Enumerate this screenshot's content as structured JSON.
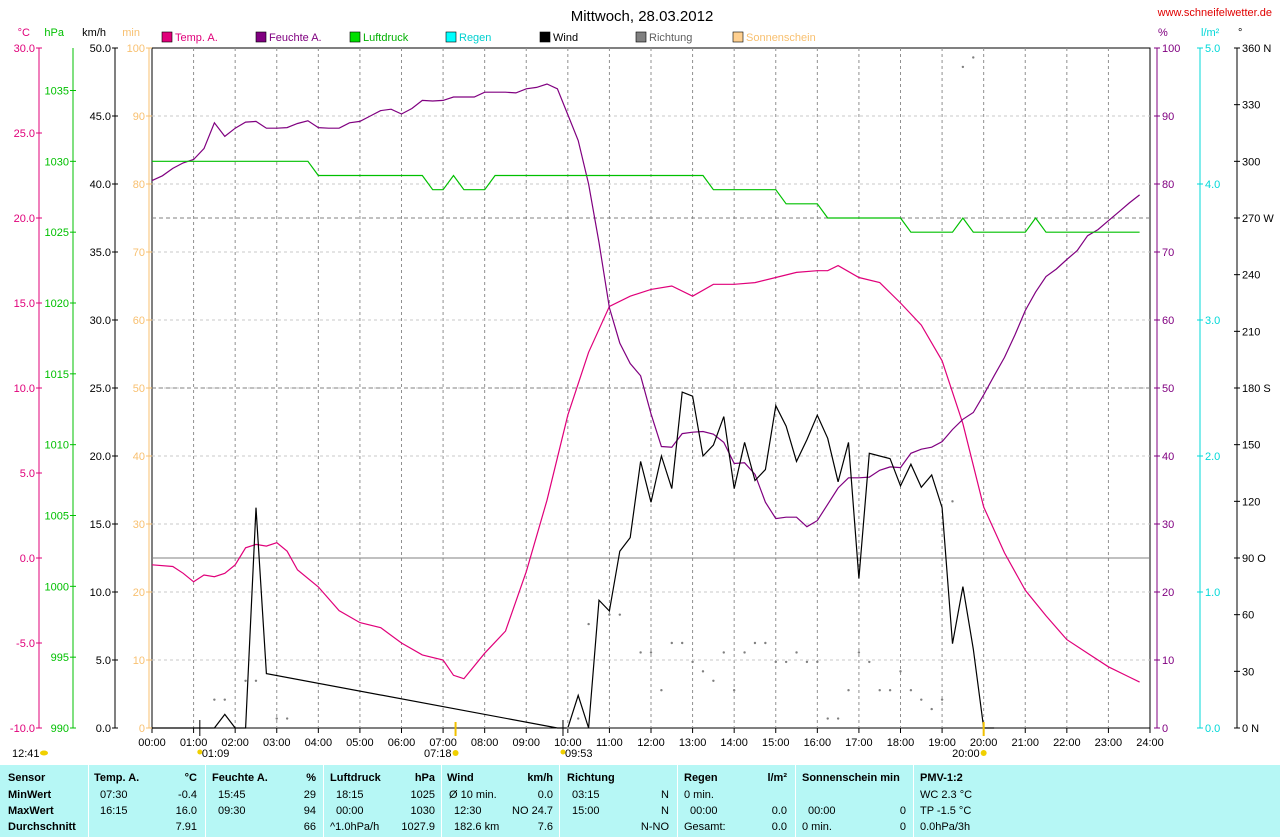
{
  "title": "Mittwoch, 28.03.2012",
  "site": "www.schneifelwetter.de",
  "colors": {
    "temp": "#e0007a",
    "humidity": "#800080",
    "pressure": "#00c000",
    "rain": "#00d8d8",
    "wind": "#000000",
    "direction": "#808080",
    "sun": "#f8c070",
    "baseline": "#808080",
    "stats_bg": "#b6f7f5"
  },
  "legend": [
    {
      "label": "Temp. A.",
      "color": "#e0007a",
      "text_color": "#e0007a"
    },
    {
      "label": "Feuchte A.",
      "color": "#800080",
      "text_color": "#800080"
    },
    {
      "label": "Luftdruck",
      "color": "#00e000",
      "text_color": "#00b000"
    },
    {
      "label": "Regen",
      "color": "#00ffff",
      "text_color": "#00d0d0"
    },
    {
      "label": "Wind",
      "color": "#000000",
      "text_color": "#000000"
    },
    {
      "label": "Richtung",
      "color": "#808080",
      "text_color": "#606060"
    },
    {
      "label": "Sonnenschein",
      "color": "#ffd090",
      "text_color": "#f8c070"
    }
  ],
  "axes": {
    "temp": {
      "unit": "°C",
      "min": -10,
      "max": 30,
      "ticks": [
        "30.0",
        "25.0",
        "20.0",
        "15.0",
        "10.0",
        "5.0",
        "0.0",
        "-5.0",
        "-10.0"
      ]
    },
    "pressure": {
      "unit": "hPa",
      "min": 990,
      "max": 1038,
      "ticks": [
        "1035",
        "1030",
        "1025",
        "1020",
        "1015",
        "1010",
        "1005",
        "1000",
        "995",
        "990"
      ]
    },
    "wind": {
      "unit": "km/h",
      "min": 0,
      "max": 50,
      "ticks": [
        "50.0",
        "45.0",
        "40.0",
        "35.0",
        "30.0",
        "25.0",
        "20.0",
        "15.0",
        "10.0",
        "5.0",
        "0.0"
      ]
    },
    "sun": {
      "unit": "min",
      "min": 0,
      "max": 100,
      "ticks": [
        "100",
        "90",
        "80",
        "70",
        "60",
        "50",
        "40",
        "30",
        "20",
        "10",
        "0"
      ]
    },
    "humidity": {
      "unit": "%",
      "min": 0,
      "max": 100,
      "ticks": [
        "100",
        "90",
        "80",
        "70",
        "60",
        "50",
        "40",
        "30",
        "20",
        "10",
        "0"
      ]
    },
    "rain": {
      "unit": "l/m²",
      "min": 0,
      "max": 5,
      "ticks": [
        "5.0",
        "4.0",
        "3.0",
        "2.0",
        "1.0",
        "0.0"
      ]
    },
    "direction": {
      "unit": "°",
      "min": 0,
      "max": 360,
      "ticks": [
        "360 N",
        "330",
        "300",
        "270 W",
        "240",
        "210",
        "180 S",
        "150",
        "120",
        "90 O",
        "60",
        "30",
        "0 N"
      ]
    },
    "x": {
      "min": 0,
      "max": 24,
      "ticks": [
        "00:00",
        "01:00",
        "02:00",
        "03:00",
        "04:00",
        "05:00",
        "06:00",
        "07:00",
        "08:00",
        "09:00",
        "10:00",
        "11:00",
        "12:00",
        "13:00",
        "14:00",
        "15:00",
        "16:00",
        "17:00",
        "18:00",
        "19:00",
        "20:00",
        "21:00",
        "22:00",
        "23:00",
        "24:00"
      ]
    }
  },
  "markers": {
    "now": "12:41",
    "sunrise": "07:18",
    "sunset": "20:00",
    "moonrise": "01:09",
    "moonset": "09:53"
  },
  "chart_data": {
    "type": "line",
    "title": "Mittwoch, 28.03.2012",
    "x_unit": "hours",
    "grid": true,
    "legend_position": "top",
    "series": [
      {
        "name": "Temp. A.",
        "axis": "temp",
        "x": [
          0,
          0.5,
          0.75,
          1,
          1.25,
          1.5,
          1.75,
          2,
          2.25,
          2.5,
          2.75,
          3,
          3.25,
          3.5,
          4,
          4.5,
          5,
          5.5,
          6,
          6.5,
          7,
          7.25,
          7.5,
          8,
          8.5,
          9,
          9.5,
          10,
          10.5,
          11,
          11.5,
          12,
          12.5,
          13,
          13.5,
          14,
          14.5,
          15,
          15.5,
          16,
          16.25,
          16.5,
          17,
          17.5,
          18,
          18.5,
          19,
          19.5,
          20,
          20.5,
          21,
          21.5,
          22,
          22.5,
          23,
          23.5,
          23.75
        ],
        "values": [
          -0.4,
          -0.5,
          -0.9,
          -1.4,
          -1.0,
          -1.1,
          -0.9,
          -0.4,
          0.6,
          0.8,
          0.7,
          0.9,
          0.4,
          -0.7,
          -1.7,
          -3.1,
          -3.8,
          -4.1,
          -5.0,
          -5.7,
          -6.0,
          -6.9,
          -7.1,
          -5.6,
          -4.3,
          -0.8,
          3.4,
          8.4,
          12.1,
          14.8,
          15.4,
          15.8,
          16.0,
          15.4,
          16.1,
          16.1,
          16.2,
          16.5,
          16.8,
          16.9,
          16.9,
          17.2,
          16.5,
          16.2,
          15.0,
          13.7,
          11.6,
          7.9,
          3.0,
          0.3,
          -1.9,
          -3.4,
          -4.8,
          -5.6,
          -6.4,
          -7.0,
          -7.3
        ]
      },
      {
        "name": "Feuchte A.",
        "axis": "humidity",
        "x": [
          0,
          0.25,
          0.5,
          0.75,
          1,
          1.25,
          1.5,
          1.75,
          2,
          2.25,
          2.5,
          2.75,
          3,
          3.25,
          3.5,
          3.75,
          4,
          4.25,
          4.5,
          4.75,
          5,
          5.25,
          5.5,
          5.75,
          6,
          6.25,
          6.5,
          6.75,
          7,
          7.25,
          7.5,
          7.75,
          8,
          8.25,
          8.5,
          8.75,
          9,
          9.25,
          9.5,
          9.75,
          10,
          10.25,
          10.5,
          10.75,
          11,
          11.25,
          11.5,
          11.75,
          12,
          12.25,
          12.5,
          12.75,
          13,
          13.25,
          13.5,
          13.75,
          14,
          14.25,
          14.5,
          14.75,
          15,
          15.25,
          15.5,
          15.75,
          16,
          16.25,
          16.5,
          16.75,
          17,
          17.25,
          17.5,
          17.75,
          18,
          18.25,
          18.5,
          18.75,
          19,
          19.25,
          19.5,
          19.75,
          20,
          20.25,
          20.5,
          20.75,
          21,
          21.25,
          21.5,
          21.75,
          22,
          22.25,
          22.5,
          22.75,
          23,
          23.25,
          23.5,
          23.75
        ],
        "values": [
          80.5,
          81.2,
          82.3,
          83.1,
          83.6,
          85.2,
          89.0,
          87.0,
          88.2,
          89.1,
          89.2,
          88.2,
          88.2,
          88.3,
          88.9,
          89.3,
          88.3,
          88.2,
          88.2,
          89.0,
          89.2,
          90.0,
          90.8,
          91.0,
          90.3,
          91.1,
          92.3,
          92.2,
          92.3,
          92.8,
          92.8,
          92.8,
          93.5,
          93.5,
          93.5,
          93.4,
          94.0,
          94.2,
          94.7,
          94.0,
          90.2,
          86.4,
          80.0,
          71.4,
          61.8,
          56.6,
          53.6,
          51.8,
          46.2,
          41.4,
          41.3,
          43.3,
          43.5,
          43.6,
          43.2,
          42.0,
          38.9,
          39.0,
          37.3,
          33.2,
          30.8,
          31.0,
          31.0,
          29.6,
          30.5,
          32.9,
          35.3,
          36.8,
          36.8,
          36.9,
          37.9,
          38.4,
          38.3,
          40.4,
          41.0,
          41.3,
          42.1,
          43.9,
          45.4,
          46.4,
          49.0,
          51.8,
          54.5,
          57.8,
          61.4,
          64.1,
          66.4,
          67.5,
          68.9,
          70.2,
          72.4,
          73.3,
          74.6,
          75.9,
          77.2,
          78.4
        ]
      },
      {
        "name": "Luftdruck",
        "axis": "pressure",
        "x": [
          0,
          3.75,
          4,
          6.5,
          6.75,
          7,
          7.25,
          7.5,
          8,
          8.25,
          13.25,
          13.5,
          15,
          15.25,
          16,
          16.25,
          18,
          18.25,
          19.25,
          19.5,
          19.75,
          21,
          21.25,
          21.5,
          23.75
        ],
        "values": [
          1030,
          1030,
          1029,
          1029,
          1028,
          1028,
          1029,
          1028,
          1028,
          1029,
          1029,
          1028,
          1028,
          1027,
          1027,
          1026,
          1026,
          1025,
          1025,
          1026,
          1025,
          1025,
          1026,
          1025,
          1025
        ]
      },
      {
        "name": "Wind",
        "axis": "wind",
        "x": [
          0,
          1.5,
          1.75,
          2,
          2.25,
          2.5,
          2.75,
          9.75,
          10,
          10.25,
          10.5,
          10.75,
          11,
          11.25,
          11.5,
          11.75,
          12,
          12.25,
          12.5,
          12.75,
          13,
          13.25,
          13.5,
          13.75,
          14,
          14.25,
          14.5,
          14.75,
          15,
          15.25,
          15.5,
          15.75,
          16,
          16.25,
          16.5,
          16.75,
          17,
          17.25,
          17.5,
          17.75,
          18,
          18.25,
          18.5,
          18.75,
          19,
          19.25,
          19.5,
          19.75,
          20,
          20.25
        ],
        "values": [
          0,
          0,
          1.0,
          0,
          0,
          16.2,
          4.0,
          0,
          0,
          2.4,
          0,
          9.4,
          8.6,
          13.0,
          14.0,
          19.6,
          16.6,
          20.0,
          17.6,
          24.7,
          24.4,
          20.0,
          20.8,
          22.9,
          17.6,
          21.0,
          18.2,
          19.0,
          23.7,
          22.2,
          19.6,
          21.2,
          23.0,
          21.3,
          18.1,
          21.0,
          11.0,
          20.2,
          20.0,
          19.8,
          17.8,
          19.4,
          17.7,
          18.6,
          16.2,
          6.2,
          10.4,
          5.8,
          0,
          0
        ]
      },
      {
        "name": "Richtung",
        "axis": "direction",
        "type": "scatter",
        "x": [
          1.5,
          1.75,
          2.25,
          2.5,
          3.0,
          3.25,
          10.0,
          10.25,
          10.5,
          11.0,
          11.25,
          11.75,
          12.0,
          12.25,
          12.5,
          12.75,
          13.0,
          13.25,
          13.5,
          13.75,
          14.0,
          14.25,
          14.5,
          14.75,
          15.0,
          15.25,
          15.5,
          15.75,
          16.0,
          16.25,
          16.5,
          16.75,
          17.0,
          17.25,
          17.5,
          17.75,
          18.0,
          18.25,
          18.5,
          18.75,
          19.0,
          19.25,
          19.5,
          19.75
        ],
        "values": [
          15,
          15,
          25,
          25,
          5,
          5,
          0,
          5,
          55,
          60,
          60,
          40,
          40,
          20,
          45,
          45,
          35,
          30,
          25,
          40,
          20,
          40,
          45,
          45,
          35,
          35,
          40,
          35,
          35,
          5,
          5,
          20,
          40,
          35,
          20,
          20,
          30,
          20,
          15,
          10,
          15,
          120,
          350,
          355
        ]
      }
    ]
  },
  "stats": {
    "sensor": {
      "header": "Sensor",
      "rows": [
        "MinWert",
        "MaxWert",
        "Durchschnitt"
      ]
    },
    "temp": {
      "header": "Temp. A.",
      "unit": "°C",
      "rows": [
        [
          "07:30",
          "-0.4"
        ],
        [
          "16:15",
          "16.0"
        ],
        [
          "",
          "7.91"
        ]
      ]
    },
    "humidity": {
      "header": "Feuchte A.",
      "unit": "%",
      "rows": [
        [
          "15:45",
          "29"
        ],
        [
          "09:30",
          "94"
        ],
        [
          "",
          "66"
        ]
      ]
    },
    "pressure": {
      "header": "Luftdruck",
      "unit": "hPa",
      "rows": [
        [
          "18:15",
          "1025"
        ],
        [
          "00:00",
          "1030"
        ],
        [
          "^1.0hPa/h",
          "1027.9"
        ]
      ]
    },
    "wind": {
      "header": "Wind",
      "unit": "km/h",
      "rows": [
        [
          "Ø 10 min.",
          "0.0"
        ],
        [
          "12:30",
          "NO 24.7"
        ],
        [
          "182.6 km",
          "7.6"
        ]
      ]
    },
    "direction": {
      "header": "Richtung",
      "rows": [
        [
          "03:15",
          "N"
        ],
        [
          "15:00",
          "N"
        ],
        [
          "",
          "N-NO"
        ]
      ]
    },
    "rain": {
      "header": "Regen",
      "unit": "l/m²",
      "rows": [
        [
          "0 min.",
          ""
        ],
        [
          "00:00",
          "0.0"
        ],
        [
          "Gesamt:",
          "0.0"
        ]
      ]
    },
    "sun": {
      "header": "Sonnenschein min",
      "rows": [
        [
          "00:00",
          "0"
        ],
        [
          "0 min.",
          "0"
        ]
      ]
    },
    "pmv": {
      "header": "PMV-1:2",
      "rows": [
        "WC 2.3 °C",
        "TP -1.5 °C",
        "0.0hPa/3h"
      ]
    }
  }
}
